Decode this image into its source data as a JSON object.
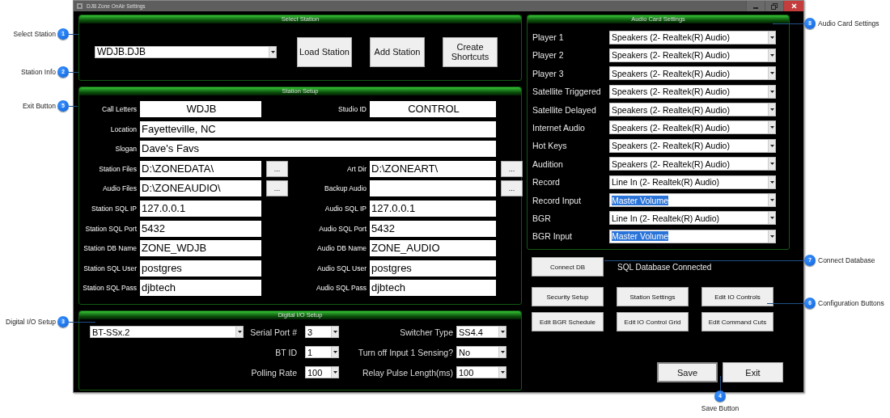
{
  "window": {
    "title": "DJB Zone OnAir Settings"
  },
  "select_station": {
    "title": "Select Station",
    "station": "WDJB.DJB",
    "buttons": [
      "Load Station",
      "Add Station",
      "Create Shortcuts"
    ]
  },
  "station_setup": {
    "title": "Station Setup",
    "rows": [
      {
        "kind": "id",
        "left": {
          "label": "Call Letters",
          "value": "WDJB"
        },
        "right": {
          "label": "Studio ID",
          "value": "CONTROL"
        }
      },
      {
        "kind": "wide",
        "label": "Location",
        "value": "Fayetteville, NC"
      },
      {
        "kind": "wide",
        "label": "Slogan",
        "value": "Dave's Favs"
      },
      {
        "kind": "pair",
        "left": {
          "label": "Station Files",
          "value": "D:\\ZONEDATA\\",
          "browse": "..."
        },
        "right": {
          "label": "Art Dir",
          "value": "D:\\ZONEART\\",
          "browse": "..."
        }
      },
      {
        "kind": "pair",
        "left": {
          "label": "Audio Files",
          "value": "D:\\ZONEAUDIO\\",
          "browse": "..."
        },
        "right": {
          "label": "Backup Audio",
          "browse": "..."
        }
      },
      {
        "kind": "pair",
        "left": {
          "label": "Station SQL IP",
          "value": "127.0.0.1"
        },
        "right": {
          "label": "Audio SQL IP",
          "value": "127.0.0.1"
        }
      },
      {
        "kind": "pair",
        "left": {
          "label": "Station SQL Port",
          "value": "5432"
        },
        "right": {
          "label": "Audio SQL Port",
          "value": "5432"
        }
      },
      {
        "kind": "pair",
        "left": {
          "label": "Station DB Name",
          "value": "ZONE_WDJB"
        },
        "right": {
          "label": "Audio DB Name",
          "value": "ZONE_AUDIO"
        }
      },
      {
        "kind": "pair",
        "left": {
          "label": "Station SQL User",
          "value": "postgres"
        },
        "right": {
          "label": "Audio SQL User",
          "value": "postgres"
        }
      },
      {
        "kind": "pair",
        "left": {
          "label": "Station SQL Pass",
          "value": "djbtech"
        },
        "right": {
          "label": "Audio SQL Pass",
          "value": "djbtech"
        }
      }
    ]
  },
  "digital_io": {
    "title": "Digital I/O Setup",
    "device": "BT-SSx.2",
    "fields": [
      {
        "label": "Serial Port #",
        "value": "3"
      },
      {
        "label": "Switcher Type",
        "value": "SS4.4"
      },
      {
        "label": "BT ID",
        "value": "1"
      },
      {
        "label": "Turn off Input 1 Sensing?",
        "value": "No"
      },
      {
        "label": "Polling Rate",
        "value": "100"
      },
      {
        "label": "Relay Pulse Length(ms)",
        "value": "100"
      }
    ]
  },
  "audio_card": {
    "title": "Audio Card Settings",
    "rows": [
      {
        "label": "Player 1",
        "value": "Speakers (2- Realtek(R) Audio)",
        "highlighted": false
      },
      {
        "label": "Player 2",
        "value": "Speakers (2- Realtek(R) Audio)",
        "highlighted": false
      },
      {
        "label": "Player 3",
        "value": "Speakers (2- Realtek(R) Audio)",
        "highlighted": false
      },
      {
        "label": "Satellite Triggered",
        "value": "Speakers (2- Realtek(R) Audio)",
        "highlighted": false
      },
      {
        "label": "Satellite Delayed",
        "value": "Speakers (2- Realtek(R) Audio)",
        "highlighted": false
      },
      {
        "label": "Internet Audio",
        "value": "Speakers (2- Realtek(R) Audio)",
        "highlighted": false
      },
      {
        "label": "Hot Keys",
        "value": "Speakers (2- Realtek(R) Audio)",
        "highlighted": false
      },
      {
        "label": "Audition",
        "value": "Speakers (2- Realtek(R) Audio)",
        "highlighted": false
      },
      {
        "label": "Record",
        "value": "Line In (2- Realtek(R) Audio)",
        "highlighted": false
      },
      {
        "label": "Record Input",
        "value": "Master Volume",
        "highlighted": true
      },
      {
        "label": "BGR",
        "value": "Line In (2- Realtek(R) Audio)",
        "highlighted": false
      },
      {
        "label": "BGR Input",
        "value": "Master Volume",
        "highlighted": true
      }
    ]
  },
  "database": {
    "button": "Connect DB",
    "status": "SQL Database Connected"
  },
  "configuration_buttons": [
    "Security Setup",
    "Station Settings",
    "Edit IO Controls",
    "Edit BGR Schedule",
    "Edit IO Control Grid",
    "Edit Command Cuts"
  ],
  "footer_buttons": [
    {
      "label": "Save",
      "focused": true
    },
    {
      "label": "Exit",
      "focused": false
    }
  ],
  "callouts": [
    {
      "number": "1",
      "label": "Select Station",
      "kind": "left"
    },
    {
      "number": "2",
      "label": "Station Info",
      "kind": "left"
    },
    {
      "number": "5",
      "label": "Exit Button",
      "kind": "left"
    },
    {
      "number": "3",
      "label": "Digital I/O Setup",
      "kind": "left"
    },
    {
      "number": "8",
      "label": "Audio Card Settings",
      "kind": "right"
    },
    {
      "number": "7",
      "label": "Connect Database",
      "kind": "right"
    },
    {
      "number": "6",
      "label": "Configuration Buttons",
      "kind": "right"
    },
    {
      "number": "4",
      "label": "Save Button",
      "kind": "below"
    }
  ]
}
